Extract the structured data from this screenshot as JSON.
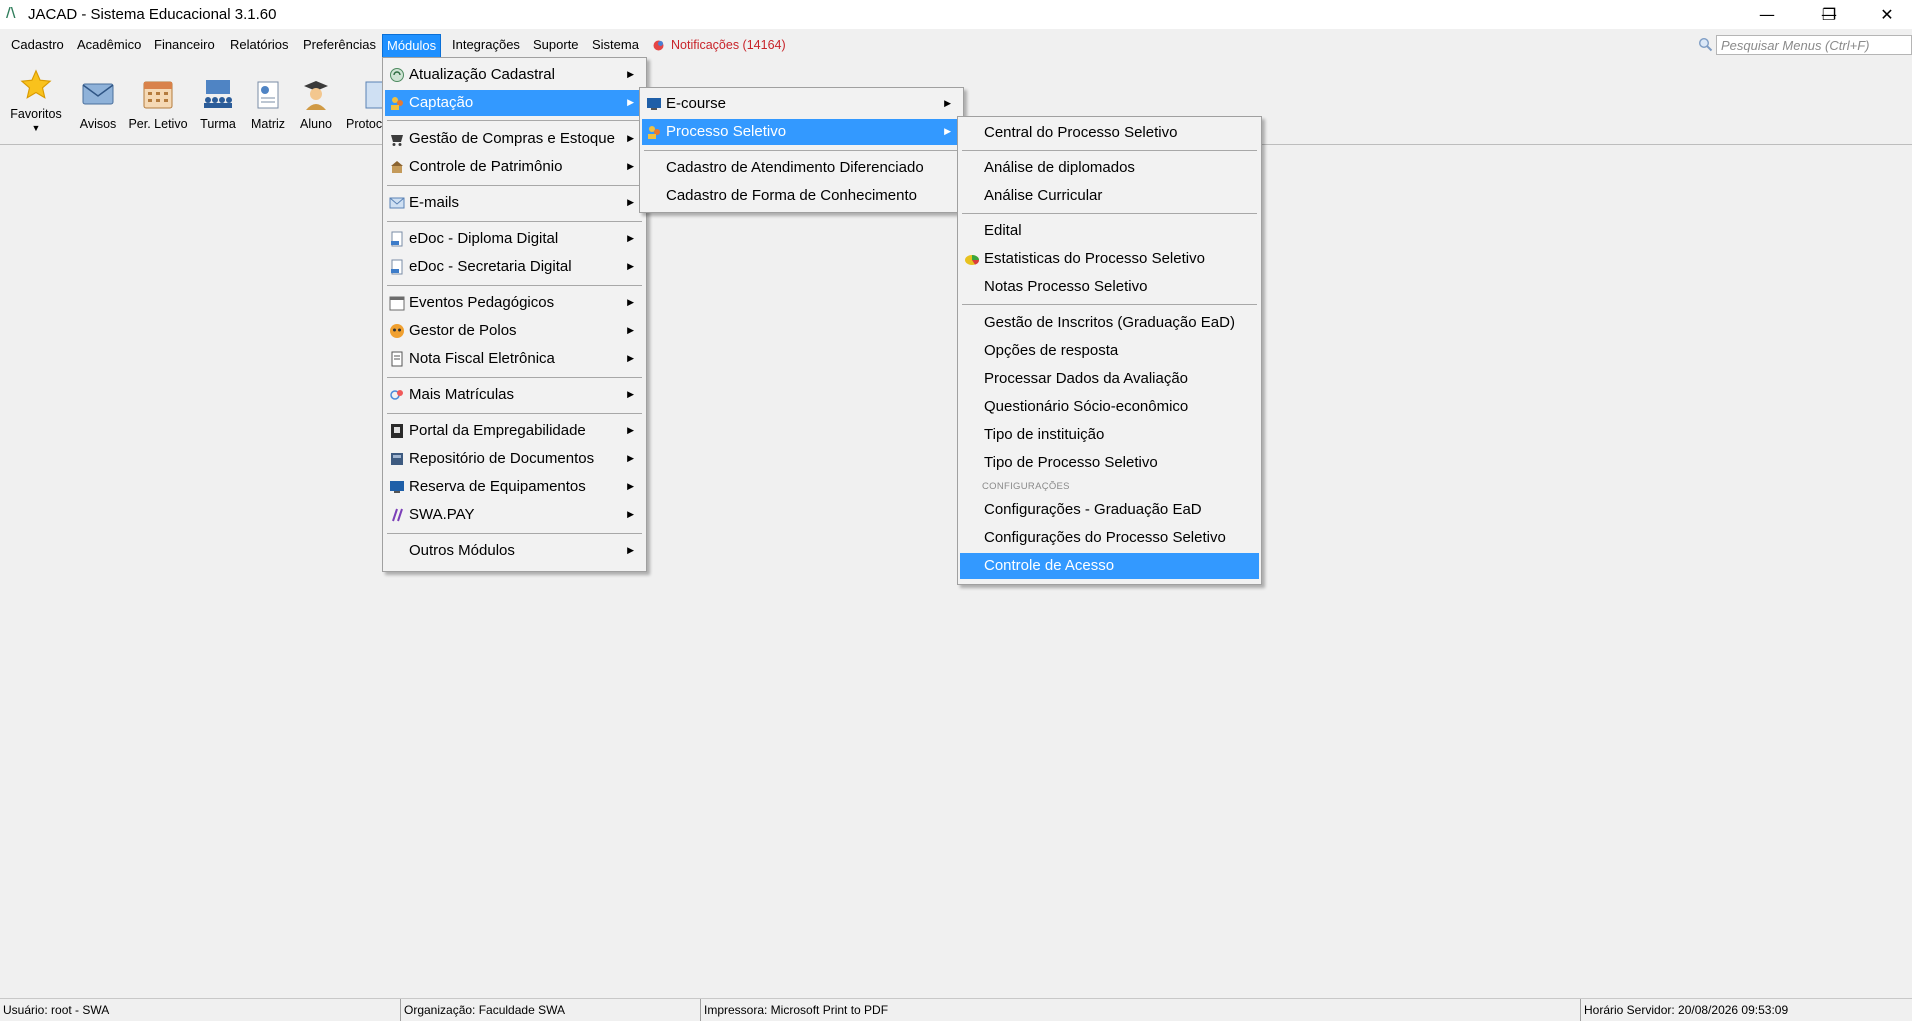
{
  "window": {
    "title": "JACAD - Sistema Educacional 3.1.60",
    "app_icon_glyph": "/\\",
    "minimize_glyph": "—",
    "restore_glyph": "❐",
    "close_glyph": "✕"
  },
  "menubar": {
    "items": [
      "Cadastro",
      "Acadêmico",
      "Financeiro",
      "Relatórios",
      "Preferências",
      "Módulos",
      "Integrações",
      "Suporte",
      "Sistema"
    ],
    "active": "Módulos",
    "notifications": "Notificações (14164)",
    "search_placeholder": "Pesquisar Menus (Ctrl+F)"
  },
  "toolbar": {
    "items": [
      "Favoritos",
      "Avisos",
      "Per. Letivo",
      "Turma",
      "Matriz",
      "Aluno",
      "Protoc"
    ]
  },
  "menu_modulos": {
    "items": [
      "Atualização Cadastral",
      "Captação",
      "Gestão de Compras e Estoque",
      "Controle de Patrimônio",
      "E-mails",
      "eDoc - Diploma Digital",
      "eDoc - Secretaria Digital",
      "Eventos Pedagógicos",
      "Gestor de Polos",
      "Nota Fiscal Eletrônica",
      "Mais Matrículas",
      "Portal da Empregabilidade",
      "Repositório de Documentos",
      "Reserva de Equipamentos",
      "SWA.PAY",
      "Outros Módulos"
    ],
    "highlighted": "Captação"
  },
  "menu_captacao": {
    "items": [
      "E-course",
      "Processo Seletivo",
      "Cadastro de Atendimento Diferenciado",
      "Cadastro de Forma de Conhecimento"
    ],
    "highlighted": "Processo Seletivo"
  },
  "menu_processo": {
    "items": [
      "Central do Processo Seletivo",
      "Análise de diplomados",
      "Análise Curricular",
      "Edital",
      "Estatisticas do Processo Seletivo",
      "Notas Processo Seletivo",
      "Gestão de Inscritos (Graduação EaD)",
      "Opções de resposta",
      "Processar Dados da Avaliação",
      "Questionário Sócio-econômico",
      "Tipo de instituição",
      "Tipo de Processo Seletivo",
      "Configurações - Graduação EaD",
      "Configurações do Processo Seletivo",
      "Controle de Acesso"
    ],
    "caption": "CONFIGURAÇÕES",
    "highlighted": "Controle de Acesso"
  },
  "statusbar": {
    "user": "Usuário: root - SWA",
    "org": "Organização: Faculdade SWA",
    "printer": "Impressora: Microsoft Print to PDF",
    "server_time": "Horário Servidor: 20/08/2026 09:53:09"
  },
  "colors": {
    "highlight": "#3399ff",
    "notification": "#c8242a",
    "background": "#f0f0f0"
  },
  "icons": {
    "arrow": "▶"
  }
}
